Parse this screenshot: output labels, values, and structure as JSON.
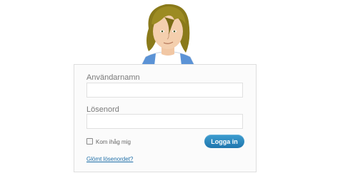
{
  "avatar": {
    "icon": "avatar-boy-icon"
  },
  "login_form": {
    "username_label": "Användarnamn",
    "username_value": "",
    "password_label": "Lösenord",
    "password_value": "",
    "remember_label": "Kom ihåg mig",
    "remember_checked": false,
    "submit_label": "Logga in",
    "forgot_link": "Glömt lösenordet?"
  },
  "colors": {
    "button": "#2a86c0",
    "link": "#1f6fa8",
    "label": "#7a7a7a",
    "card_border": "#dedede"
  }
}
